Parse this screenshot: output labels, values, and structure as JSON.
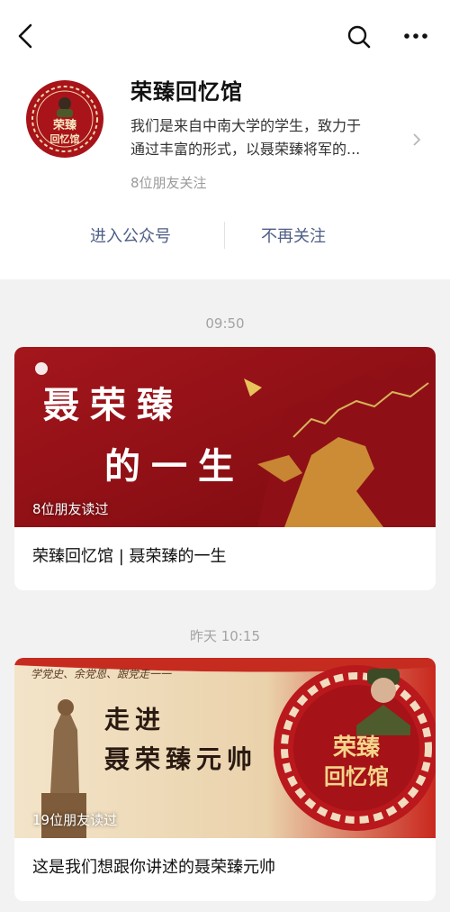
{
  "account": {
    "name": "荣臻回忆馆",
    "description_line1": "我们是来自中南大学的学生，致力于",
    "description_line2": "通过丰富的形式，以聂荣臻将军的...",
    "followers": "8位朋友关注",
    "avatar_text_line1": "荣臻",
    "avatar_text_line2": "回忆馆",
    "icons": {
      "back": "back-arrow-icon",
      "search": "search-icon",
      "more": "more-icon"
    }
  },
  "actions": {
    "enter": "进入公众号",
    "unfollow": "不再关注"
  },
  "messages": [
    {
      "time": "09:50",
      "cover_title_line1": "聂荣臻",
      "cover_title_line2": "的一生",
      "reads": "8位朋友读过",
      "title": "荣臻回忆馆 | 聂荣臻的一生"
    },
    {
      "time": "昨天 10:15",
      "cover_slogan": "学党史、余党恩、跟党走一一",
      "cover_title_line1": "走进",
      "cover_title_line2": "聂荣臻元帅",
      "badge_line1": "荣臻",
      "badge_line2": "回忆馆",
      "reads": "19位朋友读过",
      "title": "这是我们想跟你讲述的聂荣臻元帅"
    }
  ],
  "colors": {
    "link": "#4d5d86",
    "brand_red": "#a8141a",
    "gold": "#e8c25a"
  }
}
